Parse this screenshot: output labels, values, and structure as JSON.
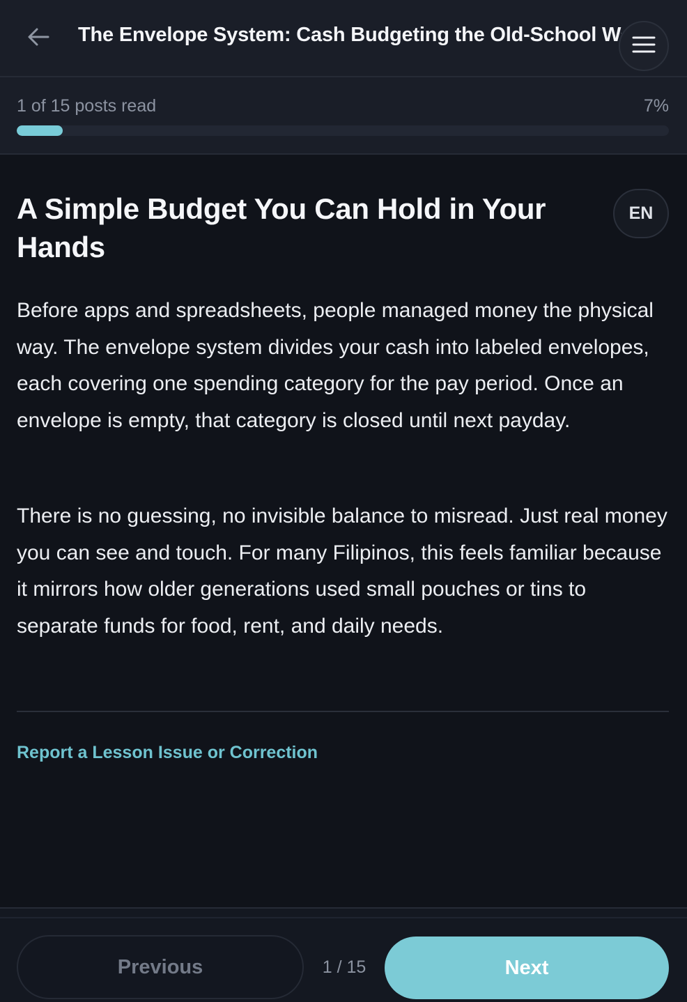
{
  "header": {
    "title": "The Envelope System: Cash Budgeting the Old-School Way",
    "back_icon": "arrow-left-icon",
    "menu_icon": "hamburger-menu-icon"
  },
  "progress": {
    "label": "1 of 15 posts read",
    "percent_label": "7%",
    "fraction": 0.07
  },
  "article": {
    "title": "A Simple Budget You Can Hold in Your Hands",
    "language": "EN",
    "paragraphs": [
      "Before apps and spreadsheets, people managed money the physical way. The envelope system divides your cash into labeled envelopes, each covering one spending category for the pay period. Once an envelope is empty, that category is closed until next payday.",
      "There is no guessing, no invisible balance to misread. Just real money you can see and touch. For many Filipinos, this feels familiar because it mirrors how older generations used small pouches or tins to separate funds for food, rent, and daily needs."
    ],
    "report_link": "Report a Lesson Issue or Correction"
  },
  "footer": {
    "previous_label": "Previous",
    "page_indicator": "1 / 15",
    "next_label": "Next"
  },
  "colors": {
    "accent": "#7ccbd6",
    "background": "#10131a",
    "header_bg": "#1a1e28"
  }
}
